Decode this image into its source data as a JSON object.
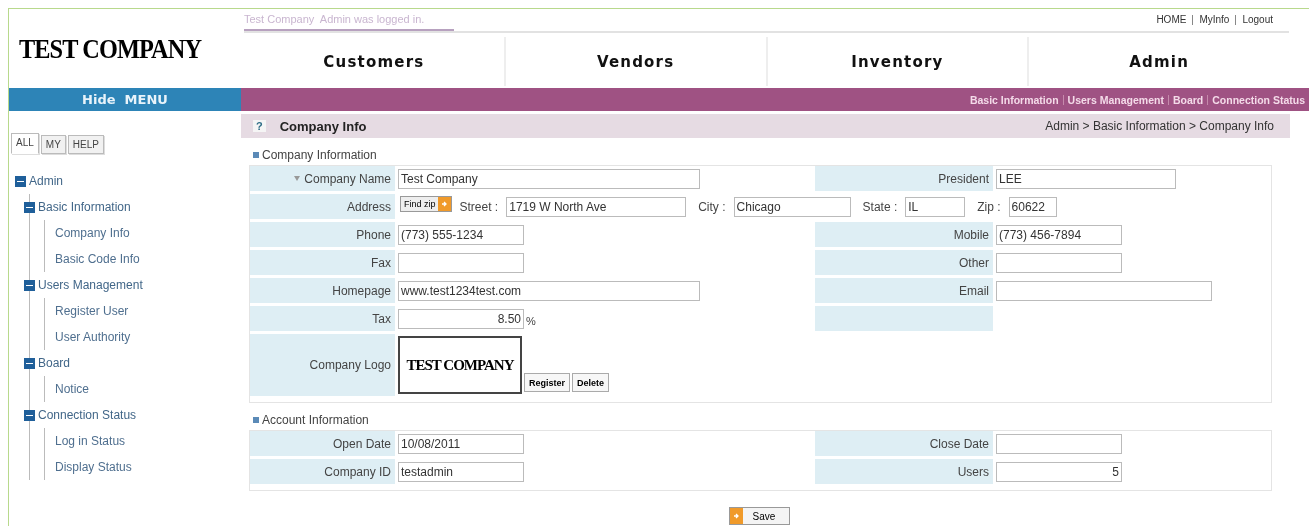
{
  "header": {
    "login_text": "Test Company  Admin was logged in.",
    "top_links": [
      "HOME",
      "MyInfo",
      "Logout"
    ],
    "logo": "TEST COMPANY"
  },
  "nav_tabs": [
    "Customers",
    "Vendors",
    "Inventory",
    "Admin"
  ],
  "menu_toggle": "Hide  MENU",
  "sub_menu": [
    "Basic Information",
    "Users Management",
    "Board",
    "Connection Status"
  ],
  "sidebar": {
    "tabs": [
      {
        "label": "ALL",
        "selected": true
      },
      {
        "label": "MY",
        "selected": false
      },
      {
        "label": "HELP",
        "selected": false
      }
    ],
    "tree": [
      {
        "label": "Admin",
        "expanded": true,
        "children": [
          {
            "label": "Basic Information",
            "expanded": true,
            "children": [
              {
                "label": "Company Info"
              },
              {
                "label": "Basic Code Info"
              }
            ]
          },
          {
            "label": "Users Management",
            "expanded": true,
            "children": [
              {
                "label": "Register User"
              },
              {
                "label": "User Authority"
              }
            ]
          },
          {
            "label": "Board",
            "expanded": true,
            "children": [
              {
                "label": "Notice"
              }
            ]
          },
          {
            "label": "Connection Status",
            "expanded": true,
            "children": [
              {
                "label": "Log in Status"
              },
              {
                "label": "Display Status"
              }
            ]
          }
        ]
      }
    ]
  },
  "page": {
    "help_icon": "?",
    "title": "Company Info",
    "breadcrumb": "Admin > Basic Information > Company Info"
  },
  "sections": [
    {
      "title": "Company Information",
      "rows": [
        {
          "kind": "pair",
          "left": {
            "label": "Company Name",
            "required": true,
            "kind": "long",
            "value": "Test Company"
          },
          "right": {
            "label": "President",
            "required": false,
            "kind": "medium",
            "value": "LEE"
          }
        },
        {
          "kind": "address",
          "label": "Address",
          "find_button": "Find zip",
          "parts": [
            {
              "label": "Street :",
              "value": "1719 W North Ave"
            },
            {
              "label": "City :",
              "value": "Chicago"
            },
            {
              "label": "State :",
              "value": "IL"
            },
            {
              "label": "Zip :",
              "value": "60622"
            }
          ]
        },
        {
          "kind": "pair",
          "left": {
            "label": "Phone",
            "required": false,
            "kind": "short",
            "value": "(773) 555-1234"
          },
          "right": {
            "label": "Mobile",
            "required": false,
            "kind": "short",
            "value": "(773) 456-7894"
          }
        },
        {
          "kind": "pair",
          "left": {
            "label": "Fax",
            "required": false,
            "kind": "short"
          },
          "right": {
            "label": "Other",
            "required": false,
            "kind": "short"
          }
        },
        {
          "kind": "pair",
          "left": {
            "label": "Homepage",
            "required": false,
            "kind": "long",
            "value": "www.test1234test.com"
          },
          "right": {
            "label": "Email",
            "required": false,
            "kind": "long"
          }
        },
        {
          "kind": "pair",
          "left": {
            "label": "Tax",
            "required": false,
            "kind": "number",
            "value": "8.50",
            "suffix": "%"
          },
          "right": {
            "kind": "blank"
          }
        },
        {
          "kind": "logo",
          "label": "Company Logo",
          "logo_text": "TEST COMPANY",
          "buttons": [
            "Register",
            "Delete"
          ]
        }
      ]
    },
    {
      "title": "Account Information",
      "rows": [
        {
          "kind": "pair",
          "left": {
            "label": "Open Date",
            "required": false,
            "kind": "short",
            "value": "10/08/2011"
          },
          "right": {
            "label": "Close Date",
            "required": false,
            "kind": "short"
          }
        },
        {
          "kind": "pair",
          "left": {
            "label": "Company ID",
            "required": false,
            "kind": "short",
            "value": "testadmin"
          },
          "right": {
            "label": "Users",
            "required": false,
            "kind": "number",
            "value": "5"
          }
        }
      ]
    }
  ],
  "save_button": "Save"
}
